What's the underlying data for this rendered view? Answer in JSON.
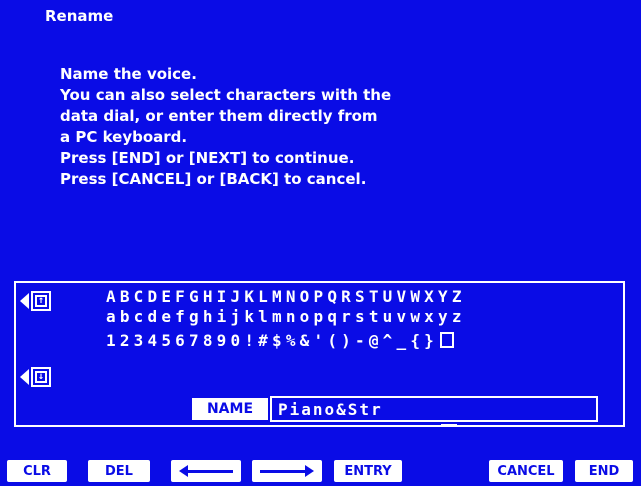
{
  "screen": {
    "title": "Rename",
    "instructions": [
      "Name the voice.",
      "You can also select characters with the",
      "data dial, or enter them directly from",
      "a PC keyboard.",
      "Press [END] or [NEXT] to continue.",
      "Press [CANCEL] or [BACK] to cancel."
    ]
  },
  "charset": {
    "row_upper": "ABCDEFGHIJKLMNOPQRSTUVWXYZ",
    "row_lower": "abcdefghijklmnopqrstuvwxyz",
    "row_symbols": "1234567890!#$%&'()-@^_{}",
    "page_up_icon": "page-up-icon",
    "page_down_icon": "page-down-icon"
  },
  "name_entry": {
    "label": "NAME",
    "value": "Piano&Str"
  },
  "function_keys": {
    "clr": "CLR",
    "del": "DEL",
    "left_icon": "left-arrow-icon",
    "right_icon": "right-arrow-icon",
    "entry": "ENTRY",
    "cancel": "CANCEL",
    "end": "END"
  },
  "colors": {
    "background": "#0a0ce6",
    "foreground": "#ffffff"
  }
}
